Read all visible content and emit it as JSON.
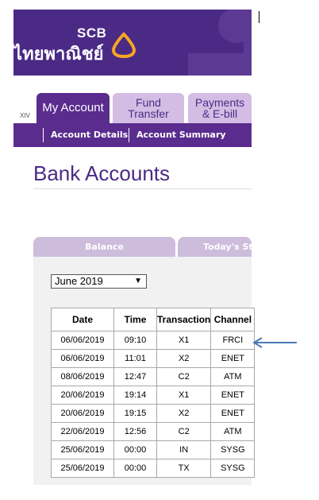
{
  "header": {
    "brand_short": "SCB",
    "brand_thai": "ไทยพาณิชย์",
    "band_color": "#4b2a85",
    "logo_color": "#f5a623"
  },
  "tabs": {
    "prefix": "XIV",
    "my_account": "My Account",
    "fund_line1": "Fund",
    "fund_line2": "Transfer",
    "pay_line1": "Payments",
    "pay_line2": "& E-bill"
  },
  "subnav": {
    "account_details": "Account Details",
    "account_summary": "Account Summary"
  },
  "page": {
    "title": "Bank Accounts"
  },
  "lower_tabs": {
    "balance": "Balance",
    "today": "Today's St"
  },
  "filter": {
    "month": "June 2019"
  },
  "table": {
    "headers": [
      "Date",
      "Time",
      "Transaction",
      "Channel"
    ],
    "rows": [
      [
        "06/06/2019",
        "09:10",
        "X1",
        "FRCI"
      ],
      [
        "06/06/2019",
        "11:01",
        "X2",
        "ENET"
      ],
      [
        "08/06/2019",
        "12:47",
        "C2",
        "ATM"
      ],
      [
        "20/06/2019",
        "19:14",
        "X1",
        "ENET"
      ],
      [
        "20/06/2019",
        "19:15",
        "X2",
        "ENET"
      ],
      [
        "22/06/2019",
        "12:56",
        "C2",
        "ATM"
      ],
      [
        "25/06/2019",
        "00:00",
        "IN",
        "SYSG"
      ],
      [
        "25/06/2019",
        "00:00",
        "TX",
        "SYSG"
      ]
    ]
  },
  "annotation": {
    "arrow_color": "#4a7ab5"
  }
}
